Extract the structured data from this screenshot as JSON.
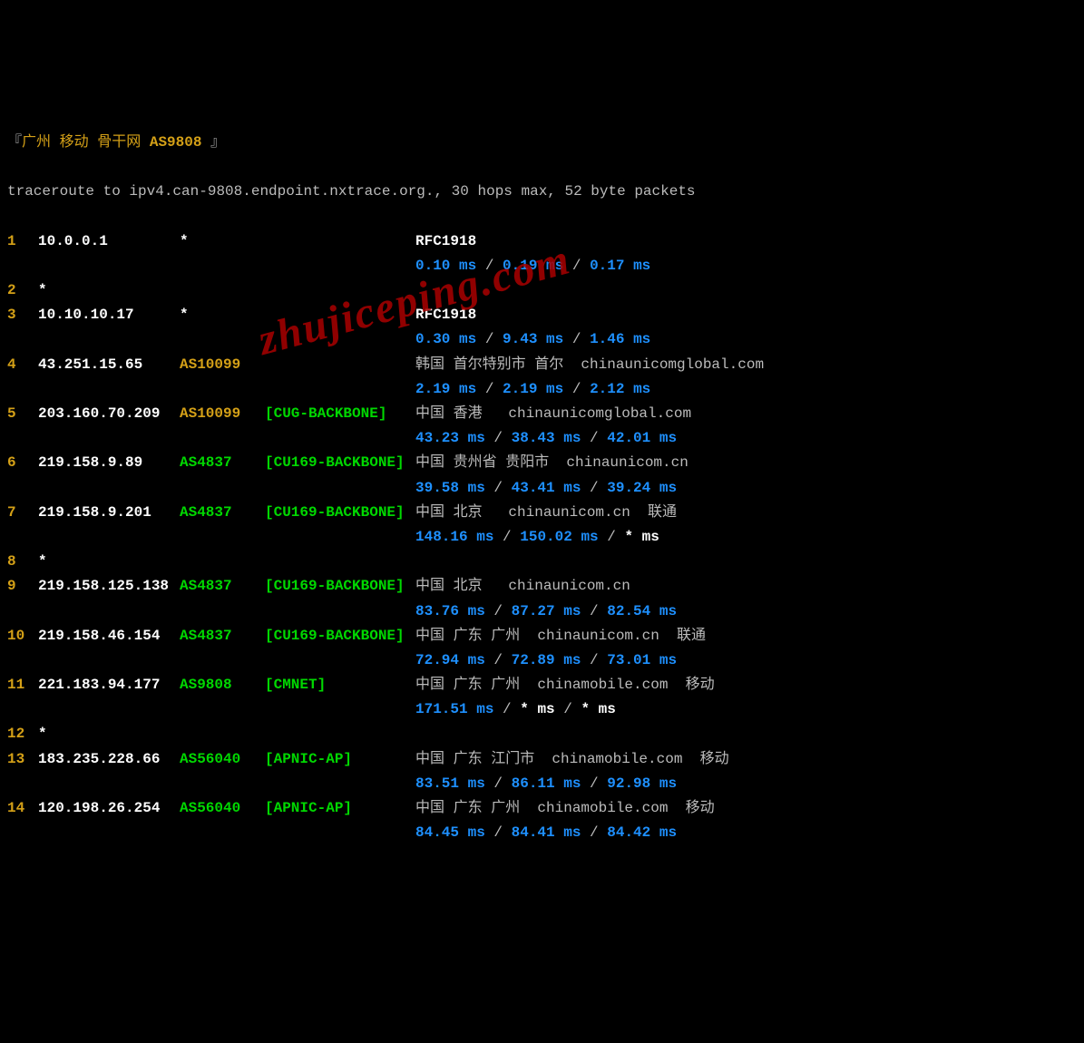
{
  "header": {
    "bracket_open": "『",
    "location": "广州 移动 骨干网",
    "as": "AS9808",
    "bracket_close": "』"
  },
  "cmd": "traceroute to ipv4.can-9808.endpoint.nxtrace.org., 30 hops max, 52 byte packets",
  "watermark": "zhujiceping.com",
  "hops": [
    {
      "num": "1",
      "ip": "10.0.0.1",
      "asn": "*",
      "asn_class": "star",
      "netname": "",
      "loc": "RFC1918",
      "loc_class": "rfc",
      "lat": [
        "0.10 ms",
        "0.19 ms",
        "0.17 ms"
      ],
      "lat_stars": [
        false,
        false,
        false
      ]
    },
    {
      "num": "2",
      "ip": "*",
      "asn": "",
      "netname": "",
      "loc": "",
      "lat": null
    },
    {
      "num": "3",
      "ip": "10.10.10.17",
      "asn": "*",
      "asn_class": "star",
      "netname": "",
      "loc": "RFC1918",
      "loc_class": "rfc",
      "lat": [
        "0.30 ms",
        "9.43 ms",
        "1.46 ms"
      ],
      "lat_stars": [
        false,
        false,
        false
      ]
    },
    {
      "num": "4",
      "ip": "43.251.15.65",
      "asn": "AS10099",
      "asn_class": "asn",
      "netname": "",
      "loc": "韩国 首尔特别市 首尔  chinaunicomglobal.com",
      "loc_class": "location",
      "lat": [
        "2.19 ms",
        "2.19 ms",
        "2.12 ms"
      ],
      "lat_stars": [
        false,
        false,
        false
      ]
    },
    {
      "num": "5",
      "ip": "203.160.70.209",
      "asn": "AS10099",
      "asn_class": "asn",
      "netname": "[CUG-BACKBONE]",
      "loc": "中国 香港   chinaunicomglobal.com",
      "loc_class": "location",
      "lat": [
        "43.23 ms",
        "38.43 ms",
        "42.01 ms"
      ],
      "lat_stars": [
        false,
        false,
        false
      ]
    },
    {
      "num": "6",
      "ip": "219.158.9.89",
      "asn": "AS4837",
      "asn_class": "asn-green",
      "netname": "[CU169-BACKBONE]",
      "loc": "中国 贵州省 贵阳市  chinaunicom.cn",
      "loc_class": "location",
      "lat": [
        "39.58 ms",
        "43.41 ms",
        "39.24 ms"
      ],
      "lat_stars": [
        false,
        false,
        false
      ]
    },
    {
      "num": "7",
      "ip": "219.158.9.201",
      "asn": "AS4837",
      "asn_class": "asn-green",
      "netname": "[CU169-BACKBONE]",
      "loc": "中国 北京   chinaunicom.cn  联通",
      "loc_class": "location",
      "lat": [
        "148.16 ms",
        "150.02 ms",
        "* ms"
      ],
      "lat_stars": [
        false,
        false,
        true
      ]
    },
    {
      "num": "8",
      "ip": "*",
      "asn": "",
      "netname": "",
      "loc": "",
      "lat": null
    },
    {
      "num": "9",
      "ip": "219.158.125.138",
      "asn": "AS4837",
      "asn_class": "asn-green",
      "netname": "[CU169-BACKBONE]",
      "loc": "中国 北京   chinaunicom.cn",
      "loc_class": "location",
      "lat": [
        "83.76 ms",
        "87.27 ms",
        "82.54 ms"
      ],
      "lat_stars": [
        false,
        false,
        false
      ]
    },
    {
      "num": "10",
      "ip": "219.158.46.154",
      "asn": "AS4837",
      "asn_class": "asn-green",
      "netname": "[CU169-BACKBONE]",
      "loc": "中国 广东 广州  chinaunicom.cn  联通",
      "loc_class": "location",
      "lat": [
        "72.94 ms",
        "72.89 ms",
        "73.01 ms"
      ],
      "lat_stars": [
        false,
        false,
        false
      ]
    },
    {
      "num": "11",
      "ip": "221.183.94.177",
      "asn": "AS9808",
      "asn_class": "asn-green",
      "netname": "[CMNET]",
      "loc": "中国 广东 广州  chinamobile.com  移动",
      "loc_class": "location",
      "lat": [
        "171.51 ms",
        "* ms",
        "* ms"
      ],
      "lat_stars": [
        false,
        true,
        true
      ]
    },
    {
      "num": "12",
      "ip": "*",
      "asn": "",
      "netname": "",
      "loc": "",
      "lat": null
    },
    {
      "num": "13",
      "ip": "183.235.228.66",
      "asn": "AS56040",
      "asn_class": "asn-green",
      "netname": "[APNIC-AP]",
      "loc": "中国 广东 江门市  chinamobile.com  移动",
      "loc_class": "location",
      "lat": [
        "83.51 ms",
        "86.11 ms",
        "92.98 ms"
      ],
      "lat_stars": [
        false,
        false,
        false
      ]
    },
    {
      "num": "14",
      "ip": "120.198.26.254",
      "asn": "AS56040",
      "asn_class": "asn-green",
      "netname": "[APNIC-AP]",
      "loc": "中国 广东 广州  chinamobile.com  移动",
      "loc_class": "location",
      "lat": [
        "84.45 ms",
        "84.41 ms",
        "84.42 ms"
      ],
      "lat_stars": [
        false,
        false,
        false
      ]
    }
  ]
}
